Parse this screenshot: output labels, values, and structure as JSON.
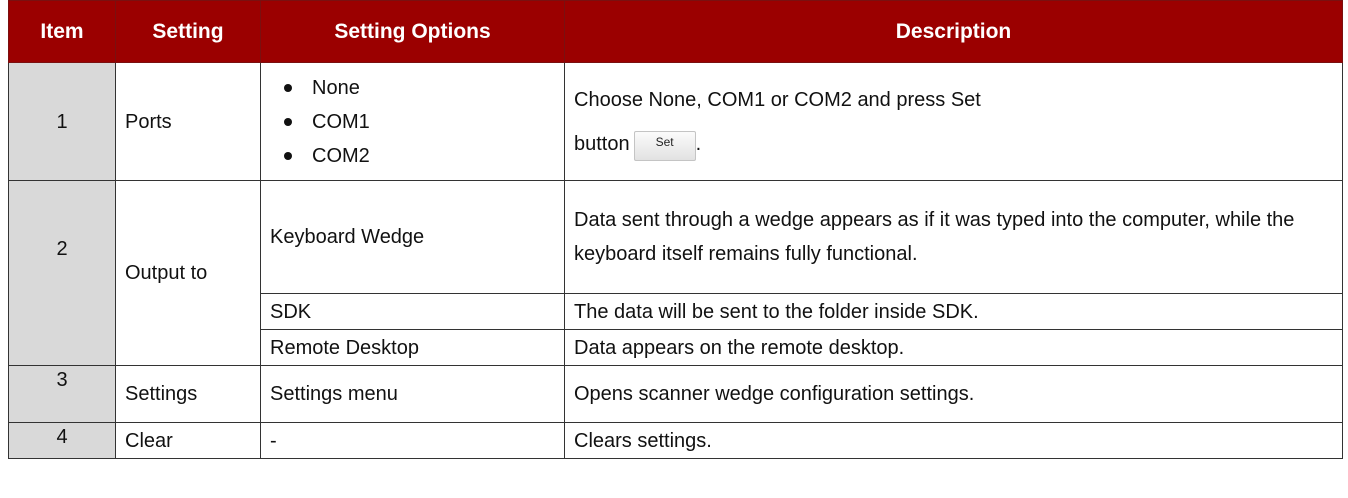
{
  "headers": {
    "item": "Item",
    "setting": "Setting",
    "options": "Setting Options",
    "description": "Description"
  },
  "rows": [
    {
      "item": "1",
      "setting": "Ports",
      "options": [
        "None",
        "COM1",
        "COM2"
      ],
      "description_line1": "Choose None, COM1 or COM2 and press Set",
      "description_line2": "button",
      "description_end": ".",
      "button_label": "Set"
    },
    {
      "item": "2",
      "setting": "Output to",
      "sub": [
        {
          "option": "Keyboard Wedge",
          "description": "Data sent through a wedge appears as if it was typed into the computer, while the keyboard itself remains fully functional."
        },
        {
          "option": "SDK",
          "description": "The data will be sent to the folder inside SDK."
        },
        {
          "option": "Remote Desktop",
          "description": "Data appears on the remote desktop."
        }
      ]
    },
    {
      "item": "3",
      "setting": "Settings",
      "option": "Settings menu",
      "description": "Opens scanner wedge configuration settings."
    },
    {
      "item": "4",
      "setting": "Clear",
      "option": "-",
      "description": "Clears settings."
    }
  ],
  "colors": {
    "header_bg": "#9b0000",
    "header_text": "#ffffff",
    "item_bg": "#d9d9d9"
  }
}
